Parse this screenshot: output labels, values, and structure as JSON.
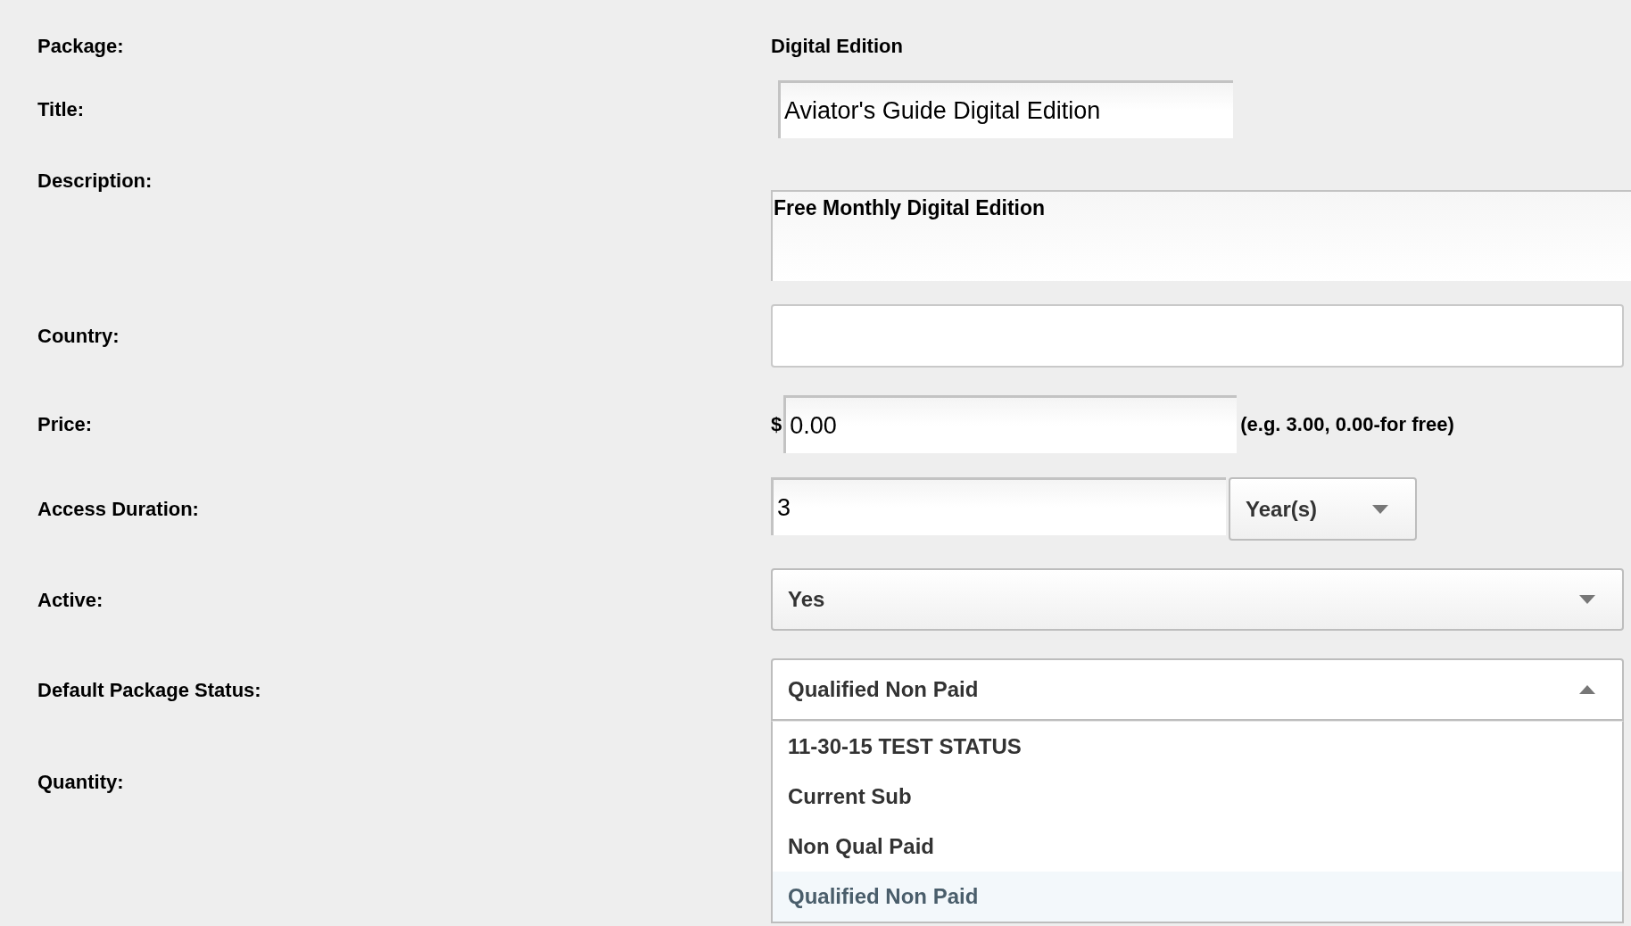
{
  "fields": [
    {
      "label": "Package:",
      "kind": "static",
      "value": "Digital Edition"
    },
    {
      "label": "Title:",
      "kind": "text",
      "value": "Aviator's Guide Digital Edition"
    },
    {
      "label": "Description:",
      "kind": "textarea",
      "value": "Free Monthly Digital Edition"
    },
    {
      "label": "Country:",
      "kind": "wide_text"
    },
    {
      "label": "Price:",
      "kind": "price",
      "prefix": "$",
      "value": "0.00",
      "hint": "(e.g. 3.00, 0.00-for free)"
    },
    {
      "label": "Access Duration:",
      "kind": "duration",
      "value": "3",
      "unit": {
        "value": "Year(s)",
        "expanded": false
      }
    },
    {
      "label": "Active:",
      "kind": "select",
      "value": "Yes",
      "expanded": false
    },
    {
      "label": "Default Package Status:",
      "kind": "select",
      "value": "Qualified Non Paid",
      "expanded": true,
      "options": [
        {
          "label": "11-30-15 TEST STATUS",
          "selected": false
        },
        {
          "label": "Current Sub",
          "selected": false
        },
        {
          "label": "Non Qual Paid",
          "selected": false
        },
        {
          "label": "Qualified Non Paid",
          "selected": true
        }
      ]
    },
    {
      "label": "Quantity:",
      "kind": "covered"
    }
  ]
}
